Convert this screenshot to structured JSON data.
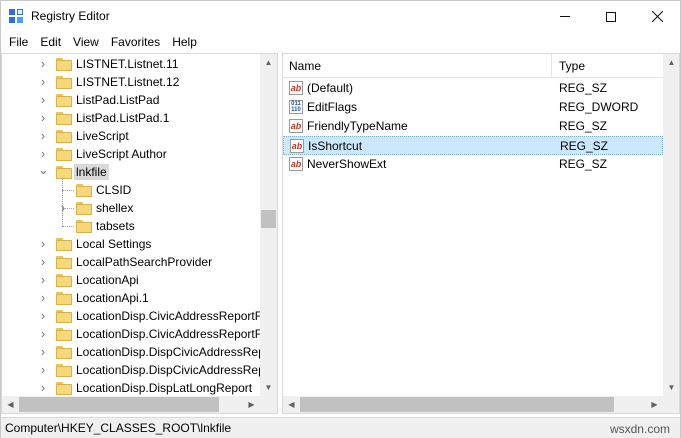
{
  "window": {
    "title": "Registry Editor",
    "app_icon": "registry-editor-icon",
    "controls": {
      "minimize": "minimize-icon",
      "maximize": "maximize-icon",
      "close": "close-icon"
    }
  },
  "menu": [
    "File",
    "Edit",
    "View",
    "Favorites",
    "Help"
  ],
  "tree": {
    "nodes": [
      {
        "label": "LISTNET.Listnet.11",
        "expander": "collapsed",
        "level": 0
      },
      {
        "label": "LISTNET.Listnet.12",
        "expander": "collapsed",
        "level": 0
      },
      {
        "label": "ListPad.ListPad",
        "expander": "collapsed",
        "level": 0
      },
      {
        "label": "ListPad.ListPad.1",
        "expander": "collapsed",
        "level": 0
      },
      {
        "label": "LiveScript",
        "expander": "collapsed",
        "level": 0
      },
      {
        "label": "LiveScript Author",
        "expander": "collapsed",
        "level": 0
      },
      {
        "label": "lnkfile",
        "expander": "expanded",
        "level": 0,
        "selected": true
      },
      {
        "label": "CLSID",
        "expander": "none",
        "level": 1
      },
      {
        "label": "shellex",
        "expander": "collapsed",
        "level": 1
      },
      {
        "label": "tabsets",
        "expander": "none",
        "level": 1
      },
      {
        "label": "Local Settings",
        "expander": "collapsed",
        "level": 0
      },
      {
        "label": "LocalPathSearchProvider",
        "expander": "collapsed",
        "level": 0
      },
      {
        "label": "LocationApi",
        "expander": "collapsed",
        "level": 0
      },
      {
        "label": "LocationApi.1",
        "expander": "collapsed",
        "level": 0
      },
      {
        "label": "LocationDisp.CivicAddressReportFa",
        "expander": "collapsed",
        "level": 0
      },
      {
        "label": "LocationDisp.CivicAddressReportFa",
        "expander": "collapsed",
        "level": 0
      },
      {
        "label": "LocationDisp.DispCivicAddressRep",
        "expander": "collapsed",
        "level": 0
      },
      {
        "label": "LocationDisp.DispCivicAddressRep",
        "expander": "collapsed",
        "level": 0
      },
      {
        "label": "LocationDisp.DispLatLongReport",
        "expander": "collapsed",
        "level": 0
      }
    ]
  },
  "list": {
    "columns": {
      "name": "Name",
      "type": "Type"
    },
    "values": [
      {
        "name": "(Default)",
        "type": "REG_SZ",
        "icon": "string-value-icon",
        "icon_text": "ab"
      },
      {
        "name": "EditFlags",
        "type": "REG_DWORD",
        "icon": "binary-value-icon",
        "icon_text": "011 110"
      },
      {
        "name": "FriendlyTypeName",
        "type": "REG_SZ",
        "icon": "string-value-icon",
        "icon_text": "ab"
      },
      {
        "name": "IsShortcut",
        "type": "REG_SZ",
        "icon": "string-value-icon",
        "icon_text": "ab",
        "selected": true
      },
      {
        "name": "NeverShowExt",
        "type": "REG_SZ",
        "icon": "string-value-icon",
        "icon_text": "ab"
      }
    ]
  },
  "status": {
    "path": "Computer\\HKEY_CLASSES_ROOT\\lnkfile",
    "watermark": "wsxdn.com"
  },
  "colors": {
    "selection_tree": "#d9d9d9",
    "selection_list": "#cce8ff",
    "folder": "#f6d77a",
    "string_icon": "#c23a2a",
    "dword_icon": "#1f4fb5"
  }
}
